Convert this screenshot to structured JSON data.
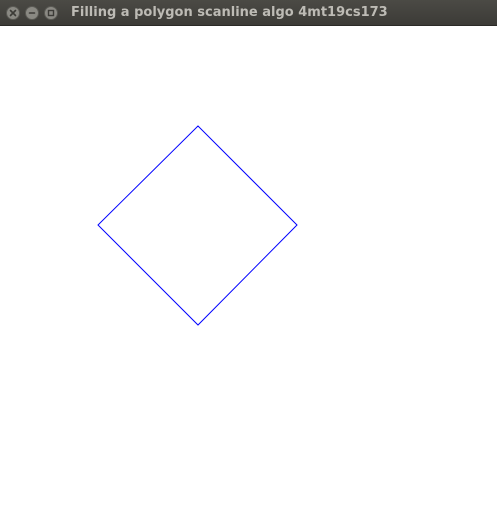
{
  "window": {
    "title": "Filling a polygon scanline algo 4mt19cs173",
    "buttons": [
      {
        "name": "close-button",
        "icon": "close-icon"
      },
      {
        "name": "minimize-button",
        "icon": "minimize-icon"
      },
      {
        "name": "maximize-button",
        "icon": "maximize-icon"
      }
    ]
  },
  "drawing": {
    "shape": "diamond polygon outline",
    "stroke_color": "#0000ff",
    "background_color": "#ffffff"
  }
}
